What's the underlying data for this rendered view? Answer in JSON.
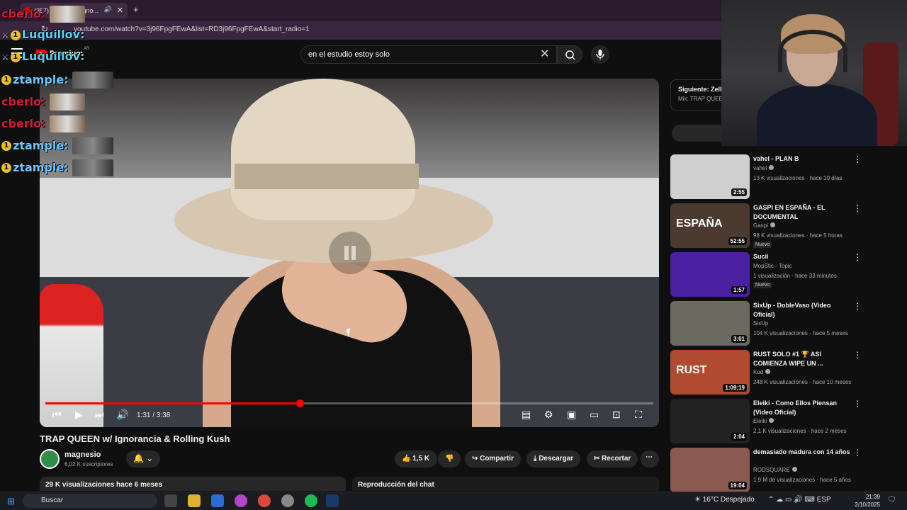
{
  "browser": {
    "tab_title": "(357) ... EEN w/ Igno...",
    "new_tab": "+",
    "url": "youtube.com/watch?v=3j96FpgFEwA&list=RD3j96FpgFEwA&start_radio=1"
  },
  "youtube_header": {
    "logo_text": "Premium",
    "country": "AR",
    "search_value": "en el estudio estoy solo"
  },
  "player": {
    "current_time": "1:31 / 3:38",
    "progress": 0.418
  },
  "video": {
    "title": "TRAP QUEEN w/ Ignorancia & Rolling Kush",
    "channel": "magnesio",
    "subscribers": "6,02 K suscriptores",
    "likes": "1,5 K",
    "share": "Compartir",
    "download": "Descargar",
    "clip": "Recortar",
    "views_date": "29 K visualizaciones  hace 6 meses",
    "chat_replay": "Reproducción del chat"
  },
  "sidebar": {
    "next_label": "Siguiente: Zell",
    "next_sub": "Mix: TRAP QUEEN",
    "recommendations": [
      {
        "title": "vahel - PLAN B",
        "channel": "vahel",
        "verified": true,
        "meta": "13 K visualizaciones · hace 10 días",
        "duration": "2:55",
        "badge": ""
      },
      {
        "title": "GASPI EN ESPAÑA - EL DOCUMENTAL",
        "channel": "Gaspi",
        "verified": true,
        "meta": "98 K visualizaciones · hace 5 horas",
        "duration": "52:55",
        "badge": "Nuevo",
        "thumb_text": "ESPAÑA"
      },
      {
        "title": "Sucii",
        "channel": "MopStic - Topic",
        "verified": false,
        "meta": "1 visualización · hace 33 minutos",
        "duration": "1:57",
        "badge": "Nuevo"
      },
      {
        "title": "SixUp - DobleVaso (Video Oficial)",
        "channel": "SixUp",
        "verified": false,
        "meta": "104 K visualizaciones · hace 5 meses",
        "duration": "3:01",
        "badge": ""
      },
      {
        "title": "RUST SOLO #1 🏆 ASI COMIENZA WIPE UN ...",
        "channel": "Kod",
        "verified": true,
        "meta": "248 K visualizaciones · hace 10 meses",
        "duration": "1:09:19",
        "badge": "",
        "thumb_text": "RUST"
      },
      {
        "title": "Eleiki - Como Ellos Piensan (Video Oficial)",
        "channel": "Eleiki",
        "verified": true,
        "meta": "2,1 K visualizaciones · hace 2 meses",
        "duration": "2:04",
        "badge": ""
      },
      {
        "title": "demasiado madura con 14 años",
        "channel": "RODSQUARE",
        "verified": true,
        "meta": "1,9 M de visualizaciones · hace 5 años",
        "duration": "19:04",
        "badge": ""
      }
    ]
  },
  "chat_overlay": [
    {
      "user": "cberlo",
      "icon": "",
      "color": "u1"
    },
    {
      "user": "Luquillov",
      "icon": "1",
      "color": "u2"
    },
    {
      "user": "Luquillov",
      "icon": "1",
      "color": "u2"
    },
    {
      "user": "ztample",
      "icon": "1",
      "color": "u3"
    },
    {
      "user": "cberlo",
      "icon": "",
      "color": "u1"
    },
    {
      "user": "cberlo",
      "icon": "",
      "color": "u1"
    },
    {
      "user": "ztample",
      "icon": "1",
      "color": "u3"
    },
    {
      "user": "ztample",
      "icon": "1",
      "color": "u3"
    }
  ],
  "taskbar": {
    "search_placeholder": "Buscar",
    "weather": "16°C  Despejado",
    "lang": "ESP",
    "time": "21:39",
    "date": "2/10/2025"
  },
  "colors": {
    "accent": "#ff0000",
    "background": "#0f0f0f"
  }
}
